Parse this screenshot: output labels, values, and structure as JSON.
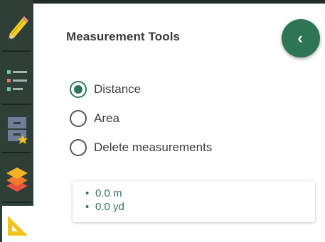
{
  "sidebar": {
    "tools": [
      {
        "name": "draw-tool",
        "icon": "pencil-icon"
      },
      {
        "name": "legend-tool",
        "icon": "list-icon"
      },
      {
        "name": "bookmarks-tool",
        "icon": "bookmark-drawer-icon"
      },
      {
        "name": "layers-tool",
        "icon": "layers-icon"
      },
      {
        "name": "measure-tool",
        "icon": "ruler-triangle-icon",
        "active": true
      }
    ]
  },
  "panel": {
    "title": "Measurement Tools",
    "collapse_icon": "‹",
    "options": [
      {
        "label": "Distance",
        "checked": true
      },
      {
        "label": "Area",
        "checked": false
      },
      {
        "label": "Delete measurements",
        "checked": false
      }
    ],
    "results": [
      "0.0 m",
      "0.0 yd"
    ]
  },
  "colors": {
    "accent": "#2e7555",
    "sidebar": "#2d3f37",
    "pencil": "#f5d21e",
    "layers": "#f2a33a",
    "ruler": "#f0c419"
  }
}
